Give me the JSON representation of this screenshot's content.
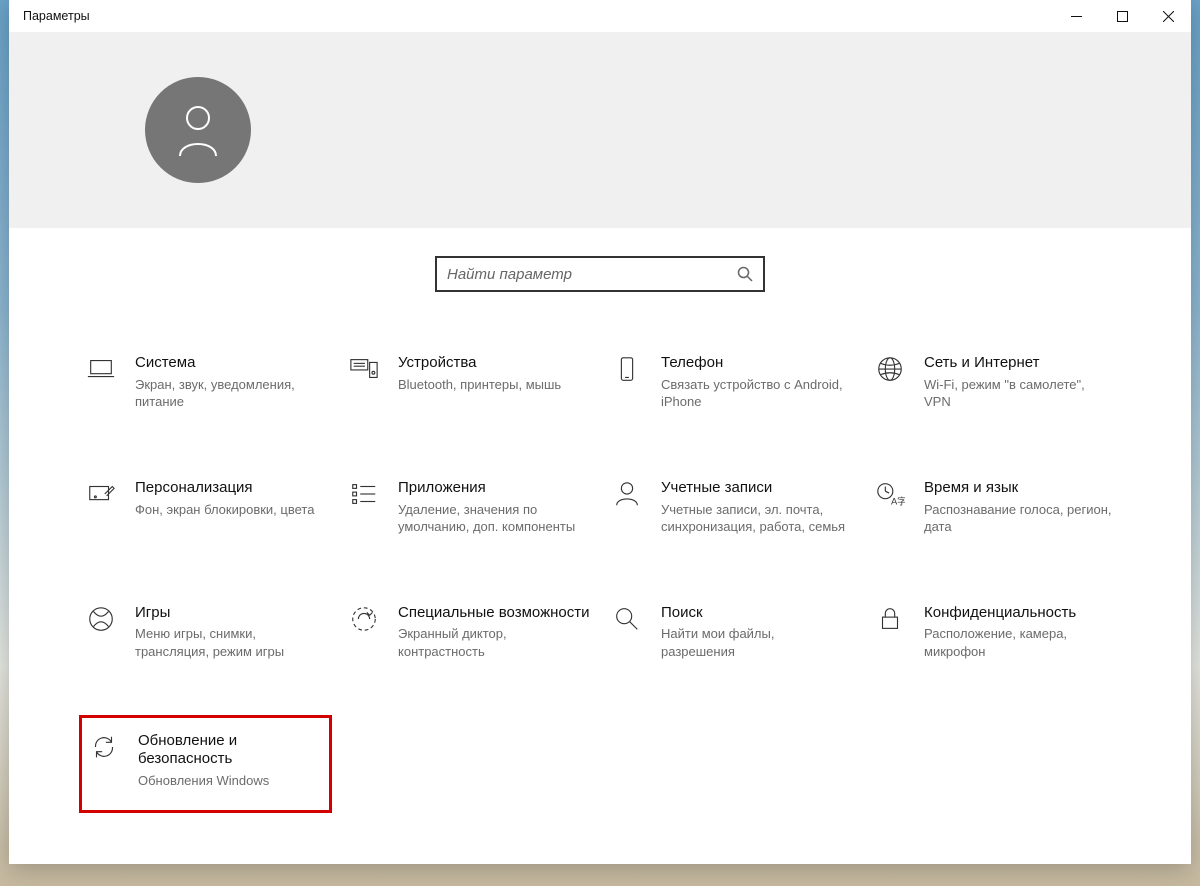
{
  "window": {
    "title": "Параметры"
  },
  "search": {
    "placeholder": "Найти параметр"
  },
  "tiles": [
    {
      "id": "system",
      "title": "Система",
      "desc": "Экран, звук, уведомления, питание"
    },
    {
      "id": "devices",
      "title": "Устройства",
      "desc": "Bluetooth, принтеры, мышь"
    },
    {
      "id": "phone",
      "title": "Телефон",
      "desc": "Связать устройство с Android, iPhone"
    },
    {
      "id": "network",
      "title": "Сеть и Интернет",
      "desc": "Wi-Fi, режим \"в самолете\", VPN"
    },
    {
      "id": "personalize",
      "title": "Персонализация",
      "desc": "Фон, экран блокировки, цвета"
    },
    {
      "id": "apps",
      "title": "Приложения",
      "desc": "Удаление, значения по умолчанию, доп. компоненты"
    },
    {
      "id": "accounts",
      "title": "Учетные записи",
      "desc": "Учетные записи, эл. почта, синхронизация, работа, семья"
    },
    {
      "id": "time",
      "title": "Время и язык",
      "desc": "Распознавание голоса, регион, дата"
    },
    {
      "id": "gaming",
      "title": "Игры",
      "desc": "Меню игры, снимки, трансляция, режим игры"
    },
    {
      "id": "accessibility",
      "title": "Специальные возможности",
      "desc": "Экранный диктор, контрастность"
    },
    {
      "id": "search-tile",
      "title": "Поиск",
      "desc": "Найти мои файлы, разрешения"
    },
    {
      "id": "privacy",
      "title": "Конфиденциальность",
      "desc": "Расположение, камера, микрофон"
    },
    {
      "id": "update",
      "title": "Обновление и безопасность",
      "desc": "Обновления Windows"
    }
  ]
}
